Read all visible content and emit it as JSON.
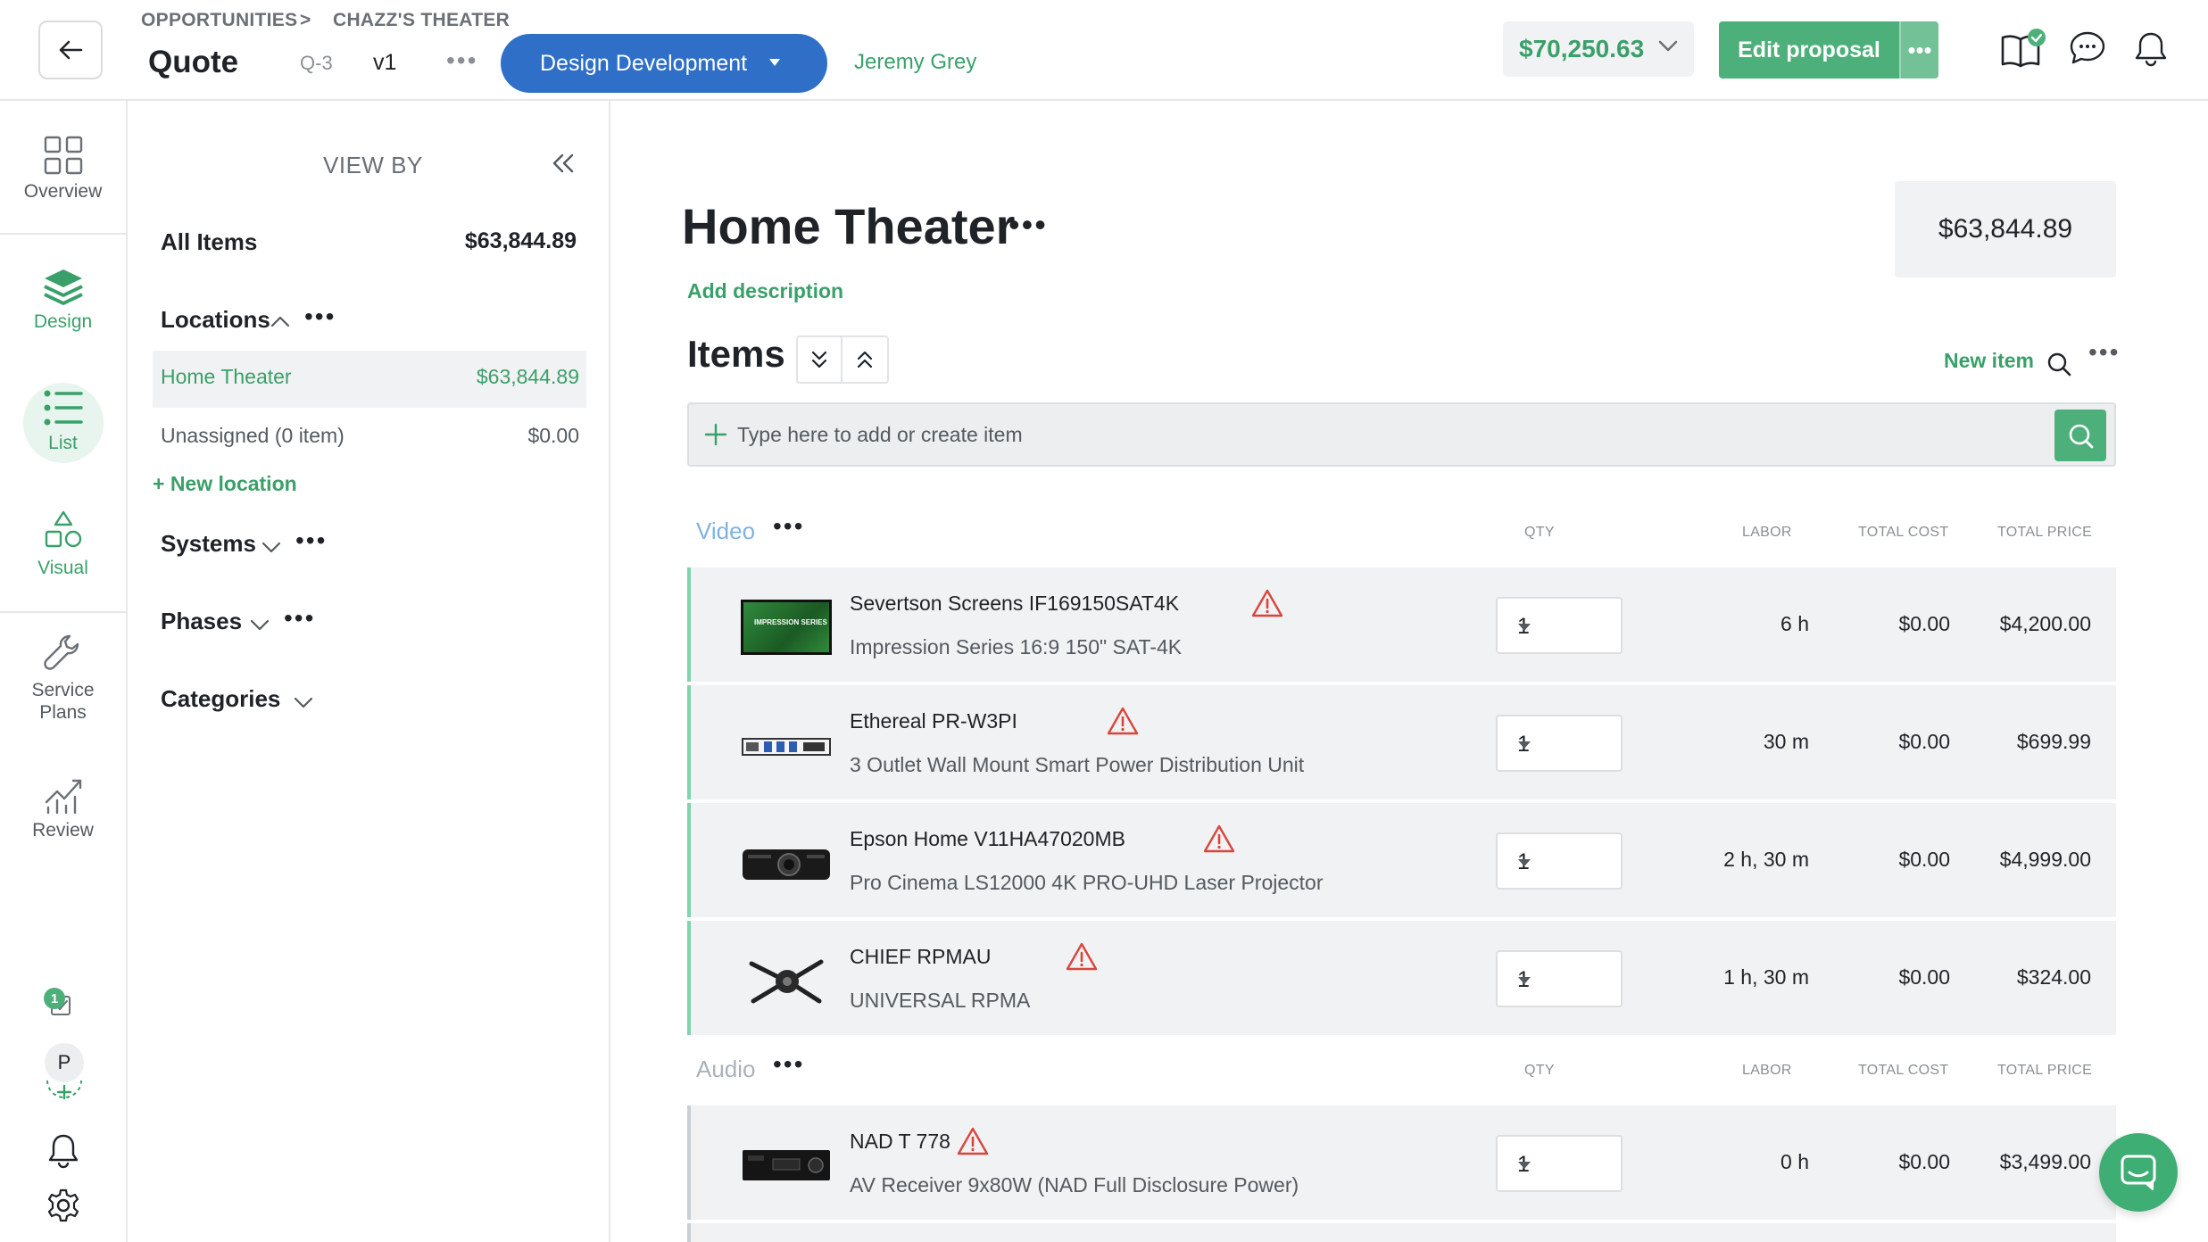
{
  "header": {
    "breadcrumbs": [
      "OPPORTUNITIES",
      "CHAZZ'S THEATER"
    ],
    "breadcrumb_separator": ">",
    "title": "Quote",
    "quote_id": "Q-3",
    "version": "v1",
    "more": "•••",
    "stage": "Design Development",
    "owner": "Jeremy Grey",
    "total": "$70,250.63",
    "edit_label": "Edit proposal",
    "edit_more": "•••",
    "icons": [
      "book-icon",
      "chat-icon",
      "bell-icon"
    ]
  },
  "rail": {
    "items": [
      {
        "label": "Overview",
        "icon": "grid-icon"
      },
      {
        "label": "Design",
        "icon": "layers-icon"
      },
      {
        "label": "List",
        "icon": "list-icon"
      },
      {
        "label": "Visual",
        "icon": "shapes-icon"
      },
      {
        "label": "Service Plans",
        "icon": "wrench-icon"
      },
      {
        "label": "Review",
        "icon": "chart-icon"
      }
    ],
    "task_count": "1",
    "avatar": "P"
  },
  "viewby": {
    "title": "VIEW BY",
    "all_items_label": "All Items",
    "all_items_amount": "$63,844.89",
    "locations_label": "Locations",
    "locations": [
      {
        "name": "Home Theater",
        "amount": "$63,844.89"
      },
      {
        "name": "Unassigned (0 item)",
        "amount": "$0.00"
      }
    ],
    "new_location": "+ New location",
    "systems_label": "Systems",
    "phases_label": "Phases",
    "categories_label": "Categories",
    "dots": "•••"
  },
  "main": {
    "section_title": "Home Theater",
    "section_total": "$63,844.89",
    "add_description": "Add description",
    "items_title": "Items",
    "new_item": "New item",
    "add_placeholder": "Type here to add or create item",
    "columns": {
      "qty": "QTY",
      "labor": "LABOR",
      "total_cost": "TOTAL COST",
      "total_price": "TOTAL PRICE"
    },
    "groups": [
      {
        "name": "Video"
      },
      {
        "name": "Audio"
      }
    ],
    "video_rows": [
      {
        "name": "Severtson Screens IF169150SAT4K",
        "desc": "Impression Series 16:9 150\" SAT-4K",
        "qty": "1",
        "labor": "6 h",
        "cost": "$0.00",
        "price": "$4,200.00"
      },
      {
        "name": "Ethereal PR-W3PI",
        "desc": "3 Outlet Wall Mount Smart Power Distribution Unit",
        "qty": "1",
        "labor": "30 m",
        "cost": "$0.00",
        "price": "$699.99"
      },
      {
        "name": "Epson Home V11HA47020MB",
        "desc": "Pro Cinema LS12000 4K PRO-UHD Laser Projector",
        "qty": "1",
        "labor": "2 h, 30 m",
        "cost": "$0.00",
        "price": "$4,999.00"
      },
      {
        "name": "CHIEF RPMAU",
        "desc": "UNIVERSAL RPMA",
        "qty": "1",
        "labor": "1 h, 30 m",
        "cost": "$0.00",
        "price": "$324.00"
      }
    ],
    "audio_rows": [
      {
        "name": "NAD T 778",
        "desc": "AV Receiver 9x80W (NAD Full Disclosure Power)",
        "qty": "1",
        "labor": "0 h",
        "cost": "$0.00",
        "price": "$3,499.00"
      }
    ],
    "thumb_text": "IMPRESSION SERIES"
  },
  "colors": {
    "accent_green": "#3aa06a",
    "button_green": "#4db07b",
    "stage_blue": "#2f6fc7",
    "group_blue": "#7fb3e0",
    "warning_red": "#d9453c"
  }
}
